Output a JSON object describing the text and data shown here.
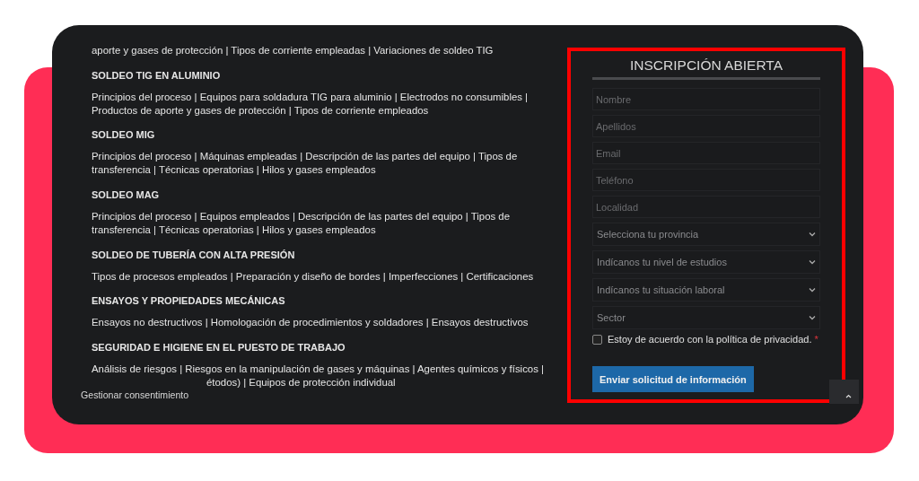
{
  "courses": [
    {
      "lines": [
        "aporte y gases de protección | Tipos de corriente empleadas | Variaciones de soldeo TIG"
      ]
    },
    {
      "heading": "SOLDEO TIG EN ALUMINIO",
      "lines": [
        "Principios del proceso | Equipos para soldadura TIG para aluminio | Electrodos no consumibles |",
        "Productos de aporte y gases de protección | Tipos de corriente empleados"
      ]
    },
    {
      "heading": "SOLDEO MIG",
      "lines": [
        "Principios del proceso | Máquinas empleadas | Descripción de las partes del equipo | Tipos de",
        "transferencia | Técnicas operatorias | Hilos y gases empleados"
      ]
    },
    {
      "heading": "SOLDEO MAG",
      "lines": [
        "Principios del proceso | Equipos empleados | Descripción de las partes del equipo | Tipos de",
        "transferencia | Técnicas operatorias | Hilos y gases empleados"
      ]
    },
    {
      "heading": "SOLDEO DE TUBERÍA CON ALTA PRESIÓN",
      "lines": [
        "Tipos de procesos empleados | Preparación y diseño de bordes | Imperfecciones | Certificaciones"
      ]
    },
    {
      "heading": "ENSAYOS Y PROPIEDADES MECÁNICAS",
      "lines": [
        "Ensayos no destructivos | Homologación de procedimientos y soldadores | Ensayos destructivos"
      ]
    },
    {
      "heading": "SEGURIDAD E HIGIENE EN EL PUESTO DE TRABAJO",
      "lines": [
        "Análisis de riesgos | Riesgos en la manipulación de gases y máquinas | Agentes químicos y físicos |"
      ],
      "partial_line": "étodos) | Equipos de protección individual"
    }
  ],
  "consent_tab": "Gestionar consentimiento",
  "form": {
    "title": "INSCRIPCIÓN ABIERTA",
    "fields": [
      {
        "kind": "text",
        "placeholder": "Nombre"
      },
      {
        "kind": "text",
        "placeholder": "Apellidos"
      },
      {
        "kind": "text",
        "placeholder": "Email"
      },
      {
        "kind": "text",
        "placeholder": "Teléfono"
      },
      {
        "kind": "text",
        "placeholder": "Localidad"
      },
      {
        "kind": "select",
        "placeholder": "Selecciona tu provincia"
      },
      {
        "kind": "select",
        "placeholder": "Indícanos tu nivel de estudios"
      },
      {
        "kind": "select",
        "placeholder": "Indícanos tu situación laboral"
      },
      {
        "kind": "select",
        "placeholder": "Sector"
      }
    ],
    "privacy": {
      "label": "Estoy de acuerdo con la política de privacidad.",
      "required_mark": "*",
      "checked": false
    },
    "submit": "Enviar solicitud de información"
  }
}
